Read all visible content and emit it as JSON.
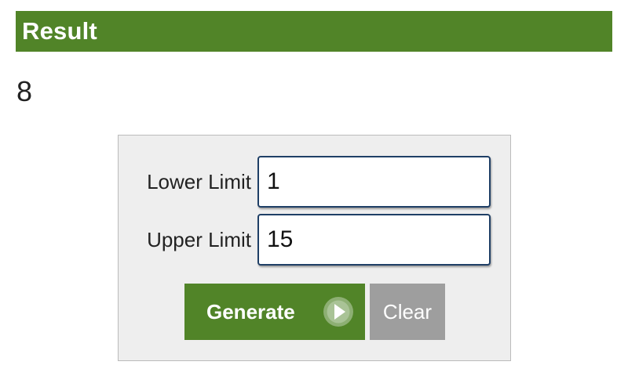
{
  "result": {
    "title": "Result",
    "value": "8"
  },
  "form": {
    "lower_limit": {
      "label": "Lower Limit",
      "value": "1"
    },
    "upper_limit": {
      "label": "Upper Limit",
      "value": "15"
    },
    "generate_label": "Generate",
    "generate_icon": "play-icon",
    "clear_label": "Clear"
  },
  "colors": {
    "accent_green": "#518428",
    "clear_gray": "#9e9e9e",
    "panel_background": "#eeeeee",
    "input_border": "#1f3f66"
  }
}
